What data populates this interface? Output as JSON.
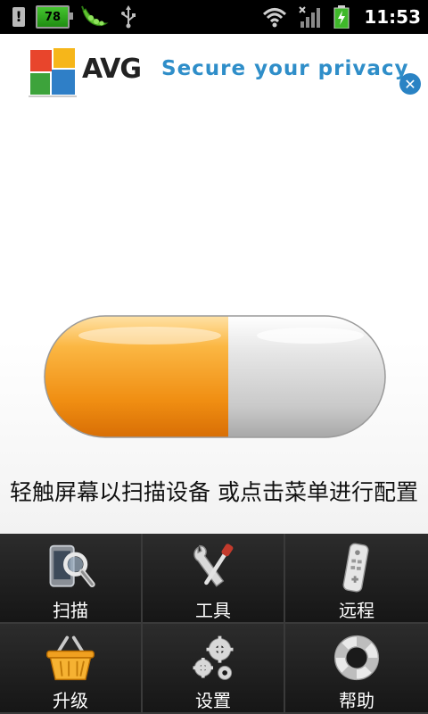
{
  "status_bar": {
    "battery_level": "78",
    "time": "11:53",
    "icons": [
      "warning-icon",
      "battery-icon",
      "pea-pod-icon",
      "usb-icon",
      "wifi-icon",
      "signal-icon",
      "charging-icon"
    ]
  },
  "banner": {
    "brand": "AVG",
    "tagline": "Secure your privacy",
    "close_label": "✕"
  },
  "main": {
    "hint": "轻触屏幕以扫描设备 或点击菜单进行配置"
  },
  "menu": {
    "items": [
      {
        "label": "扫描",
        "icon": "scan-phone-magnifier-icon"
      },
      {
        "label": "工具",
        "icon": "tools-wrench-screwdriver-icon"
      },
      {
        "label": "远程",
        "icon": "remote-control-icon"
      },
      {
        "label": "升级",
        "icon": "shopping-basket-icon"
      },
      {
        "label": "设置",
        "icon": "gears-icon"
      },
      {
        "label": "帮助",
        "icon": "lifebuoy-icon"
      }
    ]
  },
  "colors": {
    "status_bar_bg": "#000000",
    "tagline": "#2f8ec9",
    "close_button": "#2a83c4",
    "capsule_orange": "#f39a1c",
    "menu_bg": "#1a1a1a"
  }
}
